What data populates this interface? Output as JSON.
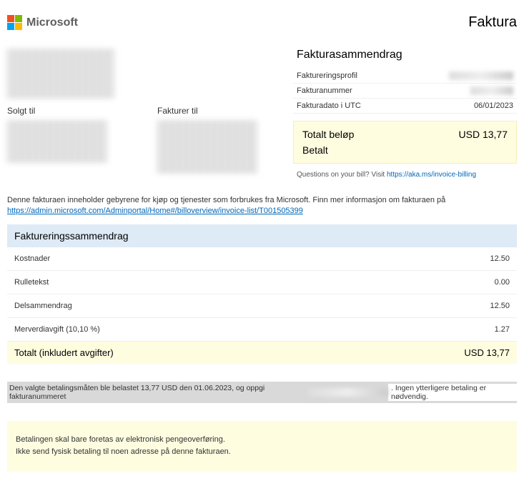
{
  "header": {
    "company": "Microsoft",
    "doc_title": "Faktura"
  },
  "addresses": {
    "sold_to_label": "Solgt til",
    "bill_to_label": "Fakturer til"
  },
  "summary": {
    "title": "Fakturasammendrag",
    "rows": [
      {
        "label": "Faktureringsprofil",
        "value": ""
      },
      {
        "label": "Fakturanummer",
        "value": ""
      },
      {
        "label": "Fakturadato i UTC",
        "value": "06/01/2023"
      }
    ],
    "total_label": "Totalt beløp",
    "total_value": "USD 13,77",
    "paid_label": "Betalt",
    "questions_prefix": "Questions on your bill? Visit ",
    "questions_link": "https://aka.ms/invoice-billing"
  },
  "description": {
    "text": "Denne fakturaen inneholder gebyrene for kjøp og tjenester som forbrukes fra Microsoft. Finn mer informasjon om fakturaen på",
    "link": "https://admin.microsoft.com/Adminportal/Home#/billoverview/invoice-list/T001505399"
  },
  "billing": {
    "header": "Faktureringssammendrag",
    "lines": [
      {
        "label": "Kostnader",
        "value": "12.50"
      },
      {
        "label": "Rulletekst",
        "value": "0.00"
      },
      {
        "label": "Delsammendrag",
        "value": "12.50"
      },
      {
        "label": "Merverdiavgift (10,10 %)",
        "value": "1.27"
      }
    ],
    "total_label": "Totalt (inkludert avgifter)",
    "total_value": "USD 13,77"
  },
  "payment_note": {
    "main": "Den valgte betalingsmåten ble belastet 13,77 USD den 01.06.2023, og oppgi fakturanummeret",
    "tail": ". Ingen ytterligere betaling er nødvendig."
  },
  "footer": {
    "line1": "Betalingen skal bare foretas av elektronisk pengeoverføring.",
    "line2": "Ikke send fysisk betaling til noen adresse på denne fakturaen."
  }
}
